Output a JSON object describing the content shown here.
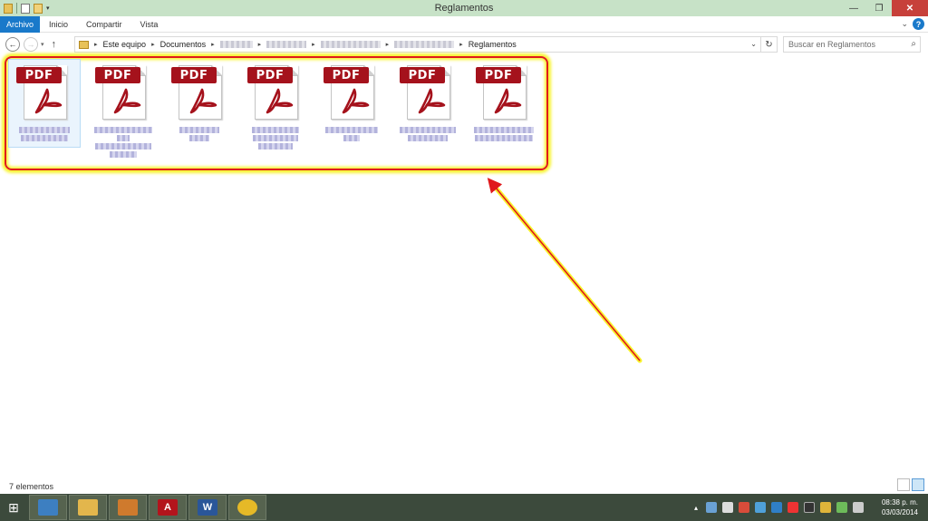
{
  "window": {
    "title": "Reglamentos",
    "controls": {
      "minimize": "—",
      "restore": "❐",
      "close": "✕"
    }
  },
  "ribbon": {
    "tabs": [
      "Archivo",
      "Inicio",
      "Compartir",
      "Vista"
    ],
    "active_tab": "Archivo",
    "help": "?"
  },
  "address": {
    "crumbs": [
      "Este equipo",
      "Documentos",
      "Reglamentos"
    ]
  },
  "search": {
    "placeholder": "Buscar en Reglamentos"
  },
  "files": {
    "icon_label": "PDF",
    "count": 7
  },
  "status": {
    "item_count": "7 elementos"
  },
  "taskbar": {
    "apps": [
      {
        "name": "outlook",
        "glyph": "",
        "color": "#3d7fc1"
      },
      {
        "name": "explorer",
        "glyph": "",
        "color": "#e3b64c"
      },
      {
        "name": "slides",
        "glyph": "",
        "color": "#cf7a2d"
      },
      {
        "name": "acrobat",
        "glyph": "A",
        "color": "#b3141c"
      },
      {
        "name": "word",
        "glyph": "W",
        "color": "#2a5699"
      },
      {
        "name": "chrome",
        "glyph": "",
        "color": "#e6b927"
      }
    ],
    "clock_time": "08:38 p. m.",
    "clock_date": "03/03/2014"
  },
  "colors": {
    "titlebar": "#c7e2c7",
    "accent": "#1979ca",
    "pdf_red": "#a5121c",
    "annotation_red": "#e0191c",
    "annotation_glow": "#f8f32c"
  }
}
